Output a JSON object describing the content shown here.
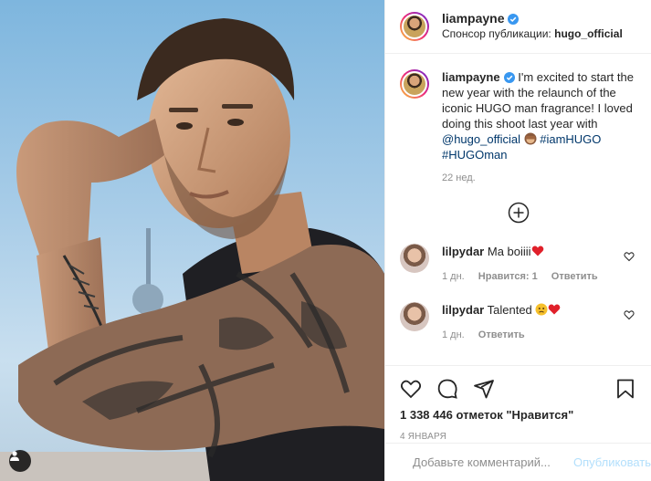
{
  "colors": {
    "link": "#00376b",
    "verified": "#3897f0",
    "muted": "#8e8e8e",
    "publish": "#b2dffc",
    "heart": "#ed4956"
  },
  "header": {
    "username": "liampayne",
    "sponsor_prefix": "Спонсор публикации:",
    "sponsor_account": "hugo_official"
  },
  "caption": {
    "username": "liampayne",
    "text": "I'm excited to start the new year with the relaunch of the iconic HUGO man fragrance! I loved doing this shoot last year with",
    "mention": "@hugo_official",
    "emoji_icon": "see-no-evil-monkey-icon",
    "hashtag1": "#iamHUGO",
    "hashtag2": "#HUGOman",
    "time": "22 нед."
  },
  "load_more_icon": "plus-circle-icon",
  "comments": [
    {
      "username": "lilpydar",
      "text": "Ma boiiii",
      "emoji_icon": "red-heart-icon",
      "age": "1 дн.",
      "likes": "Нравится: 1",
      "reply": "Ответить"
    },
    {
      "username": "lilpydar",
      "text": "Talented",
      "emoji_icons": [
        "sad-face-icon",
        "red-heart-icon"
      ],
      "age": "1 дн.",
      "reply": "Ответить"
    }
  ],
  "actions": {
    "icons": [
      "heart-icon",
      "comment-icon",
      "share-icon",
      "bookmark-icon"
    ],
    "likes": "1 338 446 отметок \"Нравится\"",
    "date": "4 ЯНВАРЯ"
  },
  "add_comment": {
    "placeholder": "Добавьте комментарий...",
    "publish": "Опубликовать"
  }
}
